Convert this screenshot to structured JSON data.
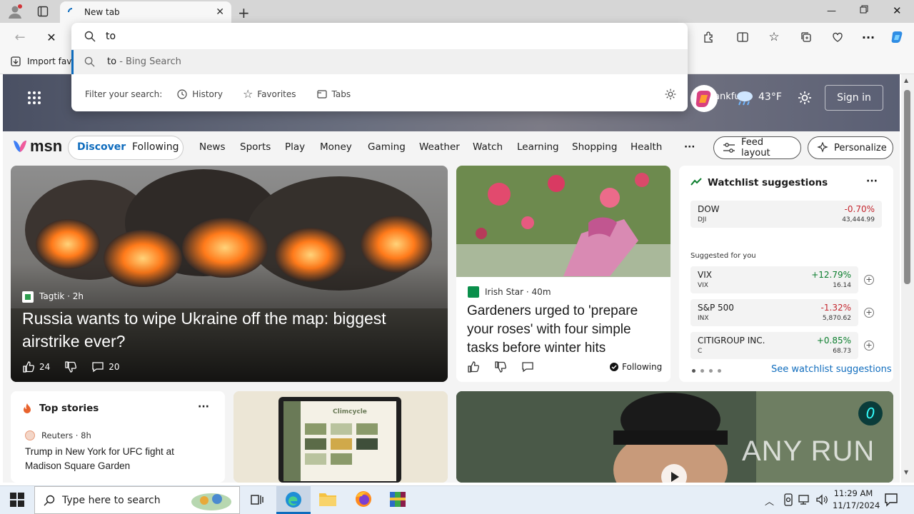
{
  "tab": {
    "title": "New tab"
  },
  "bookmarks": {
    "import_label": "Import favo"
  },
  "omnibox": {
    "value": "to",
    "suggestion_query": "to",
    "suggestion_suffix": " - Bing Search",
    "filter_label": "Filter your search:",
    "filters": [
      "History",
      "Favorites",
      "Tabs"
    ]
  },
  "hero": {
    "location": "ankfurt",
    "temperature": "43°F",
    "sign_in": "Sign in"
  },
  "msn": {
    "logo": "msn",
    "tabs": [
      "Discover",
      "Following"
    ],
    "nav": [
      "News",
      "Sports",
      "Play",
      "Money",
      "Gaming",
      "Weather",
      "Watch",
      "Learning",
      "Shopping",
      "Health"
    ],
    "more": "···",
    "feed_layout": "Feed layout",
    "personalize": "Personalize"
  },
  "main_story": {
    "source": "Tagtik",
    "time": "2h",
    "headline": "Russia wants to wipe Ukraine off the map: biggest airstrike ever?",
    "likes": "24",
    "comments": "20"
  },
  "second_story": {
    "source": "Irish Star",
    "time": "40m",
    "headline": "Gardeners urged to 'prepare your roses' with four simple tasks before winter hits",
    "following": "Following"
  },
  "watchlist": {
    "title": "Watchlist suggestions",
    "more": "···",
    "main": {
      "name": "DOW",
      "symbol": "DJI",
      "pct": "-0.70%",
      "value": "43,444.99"
    },
    "suggested_label": "Suggested for you",
    "items": [
      {
        "name": "VIX",
        "symbol": "VIX",
        "pct": "+12.79%",
        "value": "16.14"
      },
      {
        "name": "S&P 500",
        "symbol": "INX",
        "pct": "-1.32%",
        "value": "5,870.62"
      },
      {
        "name": "CITIGROUP INC.",
        "symbol": "C",
        "pct": "+0.85%",
        "value": "68.73"
      }
    ],
    "see_all": "See watchlist suggestions"
  },
  "top_stories": {
    "title": "Top stories",
    "more": "···",
    "source": "Reuters",
    "time": "8h",
    "headline": "Trump in New York for UFC fight at Madison Square Garden"
  },
  "laptop_card": {
    "brand": "Climcycle"
  },
  "watermark": "ANY RUN",
  "taskbar": {
    "search_placeholder": "Type here to search",
    "time": "11:29 AM",
    "date": "11/17/2024"
  },
  "colors": {
    "accent": "#0f6cbd",
    "up": "#0a7d2c",
    "down": "#c4262e"
  }
}
